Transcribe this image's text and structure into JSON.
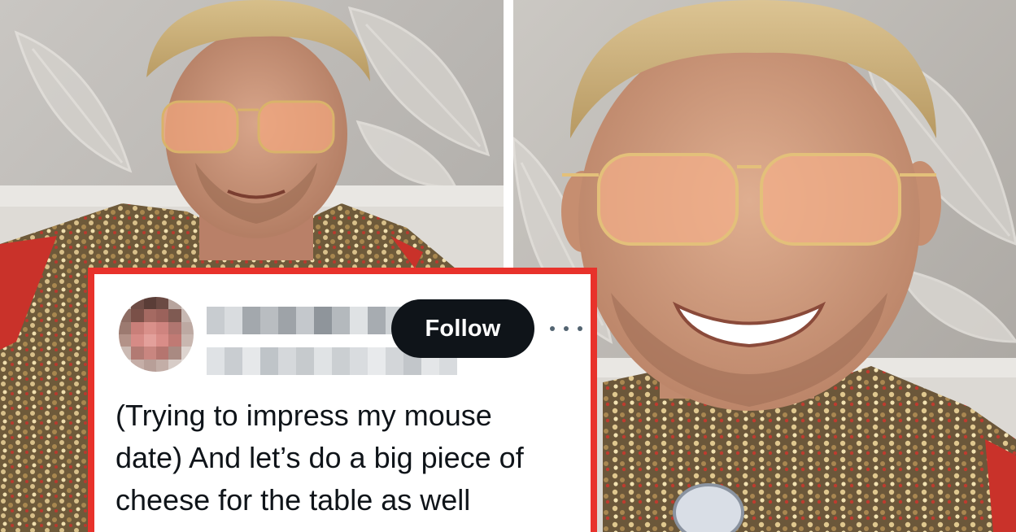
{
  "colors": {
    "frame_border": "#e8322b",
    "follow_button_bg": "#0f1419",
    "follow_button_text": "#ffffff",
    "tweet_text": "#0f1419",
    "more_dots": "#536471"
  },
  "left_photo": {
    "icon": "photo-man-tinted-glasses-sequin-jacket"
  },
  "right_photo": {
    "icon": "photo-man-smiling-tinted-glasses"
  },
  "tweet": {
    "avatar_icon": "pixelated-avatar",
    "display_name_icon": "pixelated-name",
    "handle_icon": "pixelated-handle",
    "follow_label": "Follow",
    "more_icon": "more-options-icon",
    "text_lines": [
      "(Trying to impress my mouse",
      "date) And let’s do a big piece of",
      "cheese for the table as well"
    ]
  }
}
